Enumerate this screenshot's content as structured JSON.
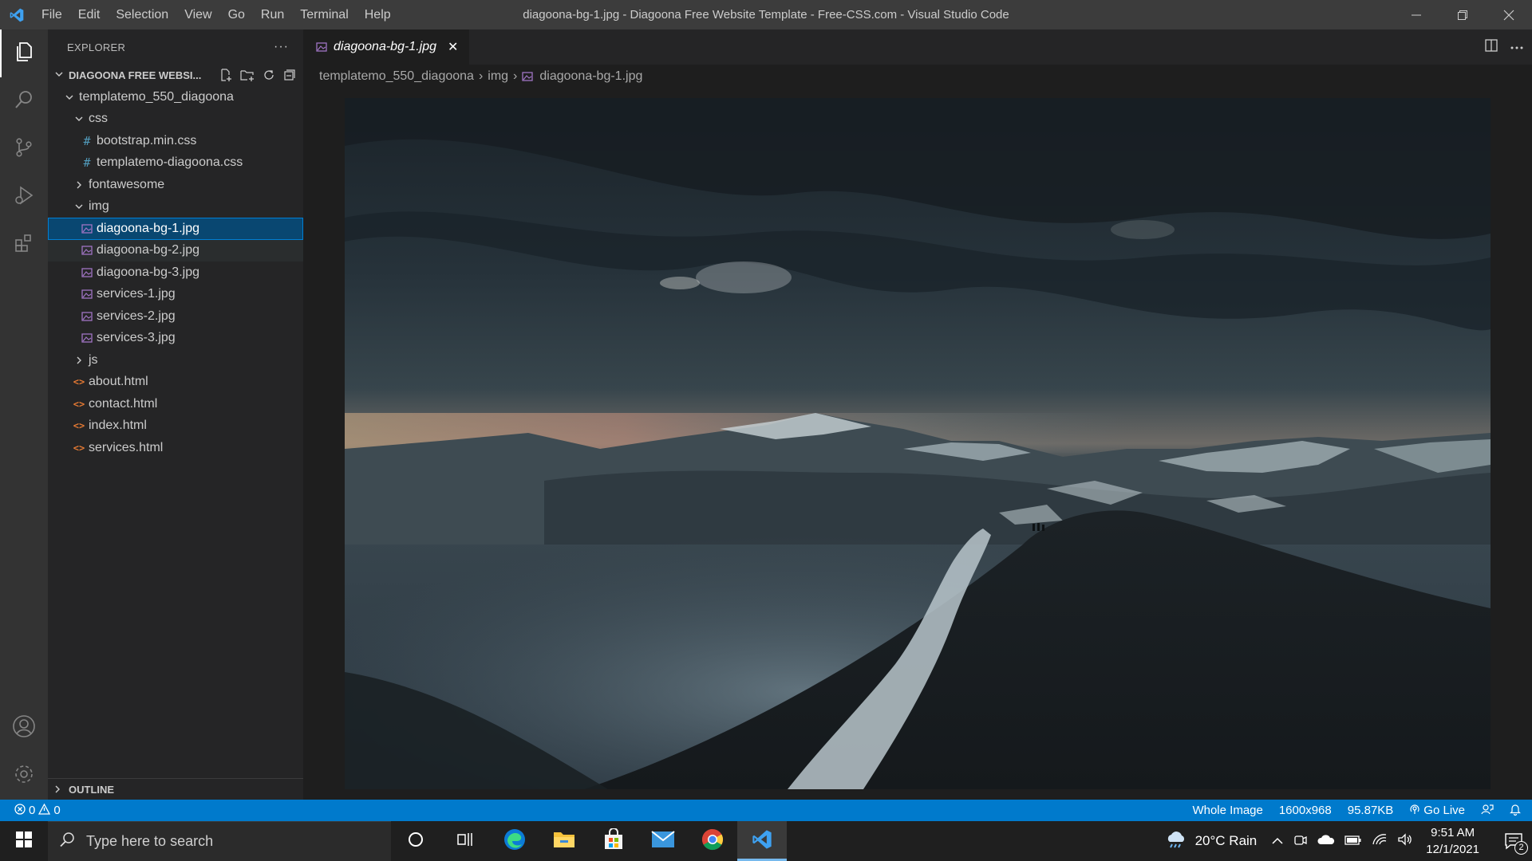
{
  "app": {
    "window_title": "diagoona-bg-1.jpg - Diagoona Free Website Template - Free-CSS.com - Visual Studio Code",
    "menu": [
      "File",
      "Edit",
      "Selection",
      "View",
      "Go",
      "Run",
      "Terminal",
      "Help"
    ],
    "accent": "#007acc"
  },
  "sidebar": {
    "title": "EXPLORER",
    "more": "···",
    "workspace": "DIAGOONA FREE WEBSI...",
    "tree": [
      {
        "label": "templatemo_550_diagoona",
        "kind": "folder-open",
        "depth": 0
      },
      {
        "label": "css",
        "kind": "folder-open",
        "depth": 1
      },
      {
        "label": "bootstrap.min.css",
        "kind": "css",
        "depth": 2
      },
      {
        "label": "templatemo-diagoona.css",
        "kind": "css",
        "depth": 2
      },
      {
        "label": "fontawesome",
        "kind": "folder-closed",
        "depth": 1
      },
      {
        "label": "img",
        "kind": "folder-open",
        "depth": 1
      },
      {
        "label": "diagoona-bg-1.jpg",
        "kind": "image",
        "depth": 2,
        "selected": true
      },
      {
        "label": "diagoona-bg-2.jpg",
        "kind": "image",
        "depth": 2
      },
      {
        "label": "diagoona-bg-3.jpg",
        "kind": "image",
        "depth": 2
      },
      {
        "label": "services-1.jpg",
        "kind": "image",
        "depth": 2
      },
      {
        "label": "services-2.jpg",
        "kind": "image",
        "depth": 2
      },
      {
        "label": "services-3.jpg",
        "kind": "image",
        "depth": 2
      },
      {
        "label": "js",
        "kind": "folder-closed",
        "depth": 1
      },
      {
        "label": "about.html",
        "kind": "html",
        "depth": 1
      },
      {
        "label": "contact.html",
        "kind": "html",
        "depth": 1
      },
      {
        "label": "index.html",
        "kind": "html",
        "depth": 1
      },
      {
        "label": "services.html",
        "kind": "html",
        "depth": 1
      }
    ],
    "outline": "OUTLINE"
  },
  "editor": {
    "tab_label": "diagoona-bg-1.jpg",
    "close_glyph": "✕",
    "breadcrumb": {
      "folder": "templatemo_550_diagoona",
      "subfolder": "img",
      "file": "diagoona-bg-1.jpg",
      "sep": "›"
    }
  },
  "status": {
    "errors": "0",
    "warnings": "0",
    "zoom": "Whole Image",
    "dimensions": "1600x968",
    "size": "95.87KB",
    "go_live": "Go Live"
  },
  "taskbar": {
    "search_placeholder": "Type here to search",
    "weather": "20°C  Rain",
    "time": "9:51 AM",
    "date": "12/1/2021",
    "notifications": "2"
  }
}
